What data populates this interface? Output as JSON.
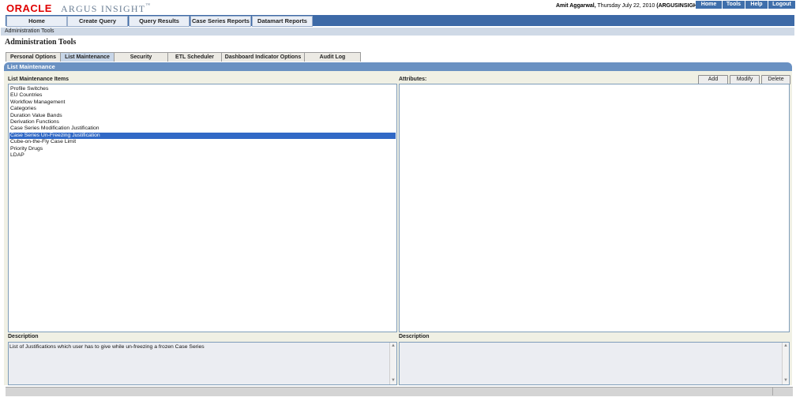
{
  "header": {
    "logo_oracle": "ORACLE",
    "logo_product": "ARGUS INSIGHT",
    "logo_tm": "™",
    "user_name": "Amit Aggarwal,",
    "date_text": " Thursday July 22, 2010 ",
    "system": "(ARGUSINSIGHT)",
    "top_links": [
      "Home",
      "Tools",
      "Help",
      "Logout"
    ]
  },
  "main_nav": [
    "Home",
    "Create Query",
    "Query Results",
    "Case Series Reports",
    "Datamart Reports"
  ],
  "breadcrumb": "Administration Tools",
  "page_title": "Administration Tools",
  "tabs": [
    "Personal Options",
    "List Maintenance",
    "Security",
    "ETL Scheduler",
    "Dashboard Indicator Options",
    "Audit Log"
  ],
  "active_tab": "List Maintenance",
  "panel_title": "List Maintenance",
  "list_section_label": "List Maintenance Items",
  "attributes_label": "Attributes:",
  "buttons": {
    "add": "Add",
    "modify": "Modify",
    "delete": "Delete"
  },
  "list_items": [
    "Profile Switches",
    "EU Countries",
    "Workflow Management",
    "Categories",
    "Duration Value Bands",
    "Derivation Functions",
    "Case Series Modification Justification",
    "Case Series Un-Freezing Justification",
    "Cube-on-the-Fly Case Limit",
    "Priority Drugs",
    "LDAP"
  ],
  "selected_item": "Case Series Un-Freezing Justification",
  "description_label_left": "Description",
  "description_label_right": "Description",
  "description_text": "List of Justifications which user has to give while un-freezing a frozen Case Series",
  "colors": {
    "accent": "#3d6aa7",
    "selection": "#3169c6",
    "panel_header": "#6a91c2"
  }
}
